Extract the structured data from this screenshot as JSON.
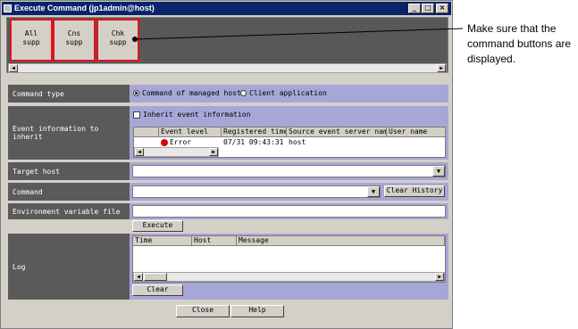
{
  "window": {
    "title": "Execute Command (jp1admin@host)"
  },
  "command_buttons": [
    {
      "line1": "All",
      "line2": "supp"
    },
    {
      "line1": "Cns",
      "line2": "supp"
    },
    {
      "line1": "Chk",
      "line2": "supp"
    }
  ],
  "form": {
    "command_type_label": "Command type",
    "command_type_options": [
      "Command of managed host",
      "Client application"
    ],
    "command_type_selected": "Command of managed host",
    "event_info_label": "Event information to inherit",
    "inherit_checkbox_label": "Inherit event information",
    "inherit_checked": false,
    "event_table": {
      "columns": [
        "",
        "Event level",
        "Registered time",
        "Source event server name",
        "User name"
      ],
      "rows": [
        {
          "level": "Error",
          "time": "07/31 09:43:31",
          "server": "host",
          "user": ""
        }
      ],
      "error_color": "#e00000"
    },
    "target_host_label": "Target host",
    "target_host_value": "",
    "command_label": "Command",
    "command_value": "",
    "clear_history_label": "Clear History",
    "env_file_label": "Environment variable file",
    "env_file_value": "",
    "execute_label": "Execute",
    "log_label": "Log",
    "log_columns": [
      "Time",
      "Host",
      "Message"
    ],
    "clear_label": "Clear"
  },
  "footer": {
    "close_label": "Close",
    "help_label": "Help"
  },
  "annotation": {
    "text": "Make sure that the command buttons are displayed."
  },
  "colors": {
    "highlight": "#e0141a",
    "field_bg": "#a7a7d7",
    "label_bg": "#5a5a5a",
    "title_bg": "#0a246a"
  }
}
